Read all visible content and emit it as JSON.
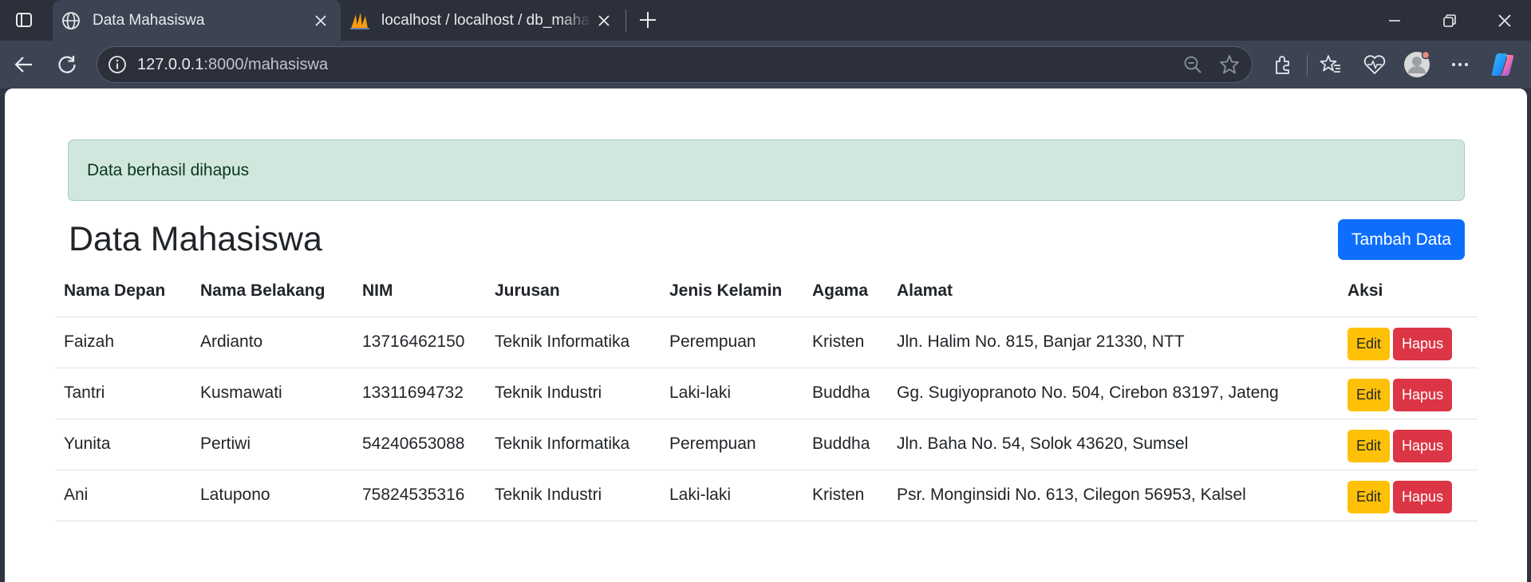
{
  "browser": {
    "tabs": [
      {
        "title": "Data Mahasiswa",
        "active": true,
        "favicon": "globe-icon"
      },
      {
        "title": "localhost / localhost / db_mahasiswa",
        "active": false,
        "favicon": "phpmyadmin-icon"
      }
    ],
    "url": {
      "host": "127.0.0.1",
      "rest": ":8000/mahasiswa"
    }
  },
  "page": {
    "alert": "Data berhasil dihapus",
    "title": "Data Mahasiswa",
    "add_button": "Tambah Data",
    "table": {
      "headers": [
        "Nama Depan",
        "Nama Belakang",
        "NIM",
        "Jurusan",
        "Jenis Kelamin",
        "Agama",
        "Alamat",
        "Aksi"
      ],
      "rows": [
        [
          "Faizah",
          "Ardianto",
          "13716462150",
          "Teknik Informatika",
          "Perempuan",
          "Kristen",
          "Jln. Halim No. 815, Banjar 21330, NTT"
        ],
        [
          "Tantri",
          "Kusmawati",
          "13311694732",
          "Teknik Industri",
          "Laki-laki",
          "Buddha",
          "Gg. Sugiyopranoto No. 504, Cirebon 83197, Jateng"
        ],
        [
          "Yunita",
          "Pertiwi",
          "54240653088",
          "Teknik Informatika",
          "Perempuan",
          "Buddha",
          "Jln. Baha No. 54, Solok 43620, Sumsel"
        ],
        [
          "Ani",
          "Latupono",
          "75824535316",
          "Teknik Industri",
          "Laki-laki",
          "Kristen",
          "Psr. Monginsidi No. 613, Cilegon 56953, Kalsel"
        ]
      ],
      "edit_label": "Edit",
      "delete_label": "Hapus"
    }
  },
  "colors": {
    "primary": "#0d6efd",
    "warning": "#ffc107",
    "danger": "#dc3545",
    "alert_bg": "#d1e7dd"
  }
}
